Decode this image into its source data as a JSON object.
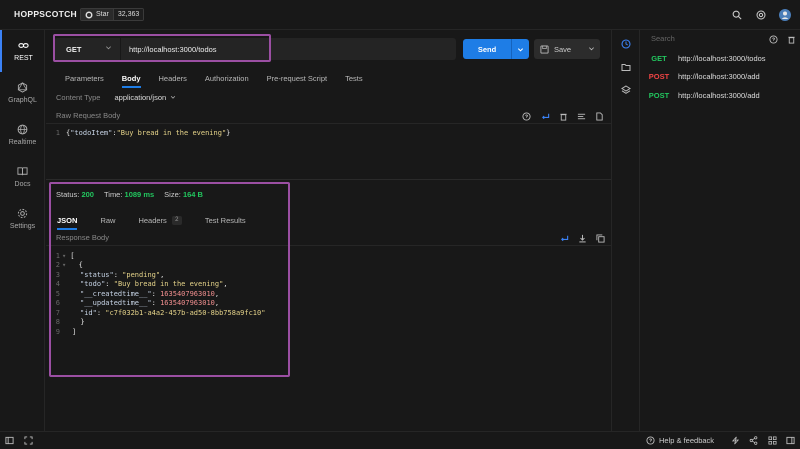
{
  "app": {
    "brand": "HOPPSCOTCH",
    "star_label": "Star",
    "star_count": "32,363"
  },
  "nav": {
    "items": [
      {
        "label": "REST",
        "icon": "link-icon"
      },
      {
        "label": "GraphQL",
        "icon": "graphql-icon"
      },
      {
        "label": "Realtime",
        "icon": "globe-icon"
      },
      {
        "label": "Docs",
        "icon": "book-icon"
      },
      {
        "label": "Settings",
        "icon": "gear-icon"
      }
    ]
  },
  "request": {
    "method": "GET",
    "url": "http://localhost:3000/todos",
    "send_label": "Send",
    "save_label": "Save"
  },
  "tabs": [
    "Parameters",
    "Body",
    "Headers",
    "Authorization",
    "Pre-request Script",
    "Tests"
  ],
  "content_type": {
    "label": "Content Type",
    "value": "application/json"
  },
  "raw_body": {
    "label": "Raw Request Body",
    "line_number": "1",
    "text_open": "{",
    "key": "\"todoItem\"",
    "colon": ":",
    "value": "\"Buy bread in the evening\"",
    "text_close": "}"
  },
  "response": {
    "status_label": "Status:",
    "status_value": "200",
    "time_label": "Time:",
    "time_value": "1089 ms",
    "size_label": "Size:",
    "size_value": "164 B",
    "tabs": [
      "JSON",
      "Raw",
      "Headers",
      "Test Results"
    ],
    "headers_count": "2",
    "body_label": "Response Body",
    "lines": [
      {
        "n": "1",
        "fold": "▾",
        "text": "["
      },
      {
        "n": "2",
        "fold": "▾",
        "text": "  {"
      },
      {
        "n": "3",
        "key": "\"status\"",
        "val": "\"pending\"",
        "type": "str",
        "tail": ","
      },
      {
        "n": "4",
        "key": "\"todo\"",
        "val": "\"Buy bread in the evening\"",
        "type": "str",
        "tail": ","
      },
      {
        "n": "5",
        "key": "\"__createdtime__\"",
        "val": "1635407963010",
        "type": "num",
        "tail": ","
      },
      {
        "n": "6",
        "key": "\"__updatedtime__\"",
        "val": "1635407963010",
        "type": "num",
        "tail": ","
      },
      {
        "n": "7",
        "key": "\"id\"",
        "val": "\"c7f032b1-a4a2-457b-ad50-8bb758a9fc10\"",
        "type": "str",
        "tail": ""
      },
      {
        "n": "8",
        "text": "  }"
      },
      {
        "n": "9",
        "text": "]"
      }
    ]
  },
  "history": {
    "search_placeholder": "Search",
    "items": [
      {
        "method": "GET",
        "color": "#22c55e",
        "url": "http://localhost:3000/todos"
      },
      {
        "method": "POST",
        "color": "#ef4444",
        "url": "http://localhost:3000/add"
      },
      {
        "method": "POST",
        "color": "#22c55e",
        "url": "http://localhost:3000/add"
      }
    ]
  },
  "footer": {
    "help_label": "Help & feedback"
  },
  "colors": {
    "accent": "#1e7de6",
    "highlight": "#9b4fa3",
    "success": "#22c55e"
  }
}
